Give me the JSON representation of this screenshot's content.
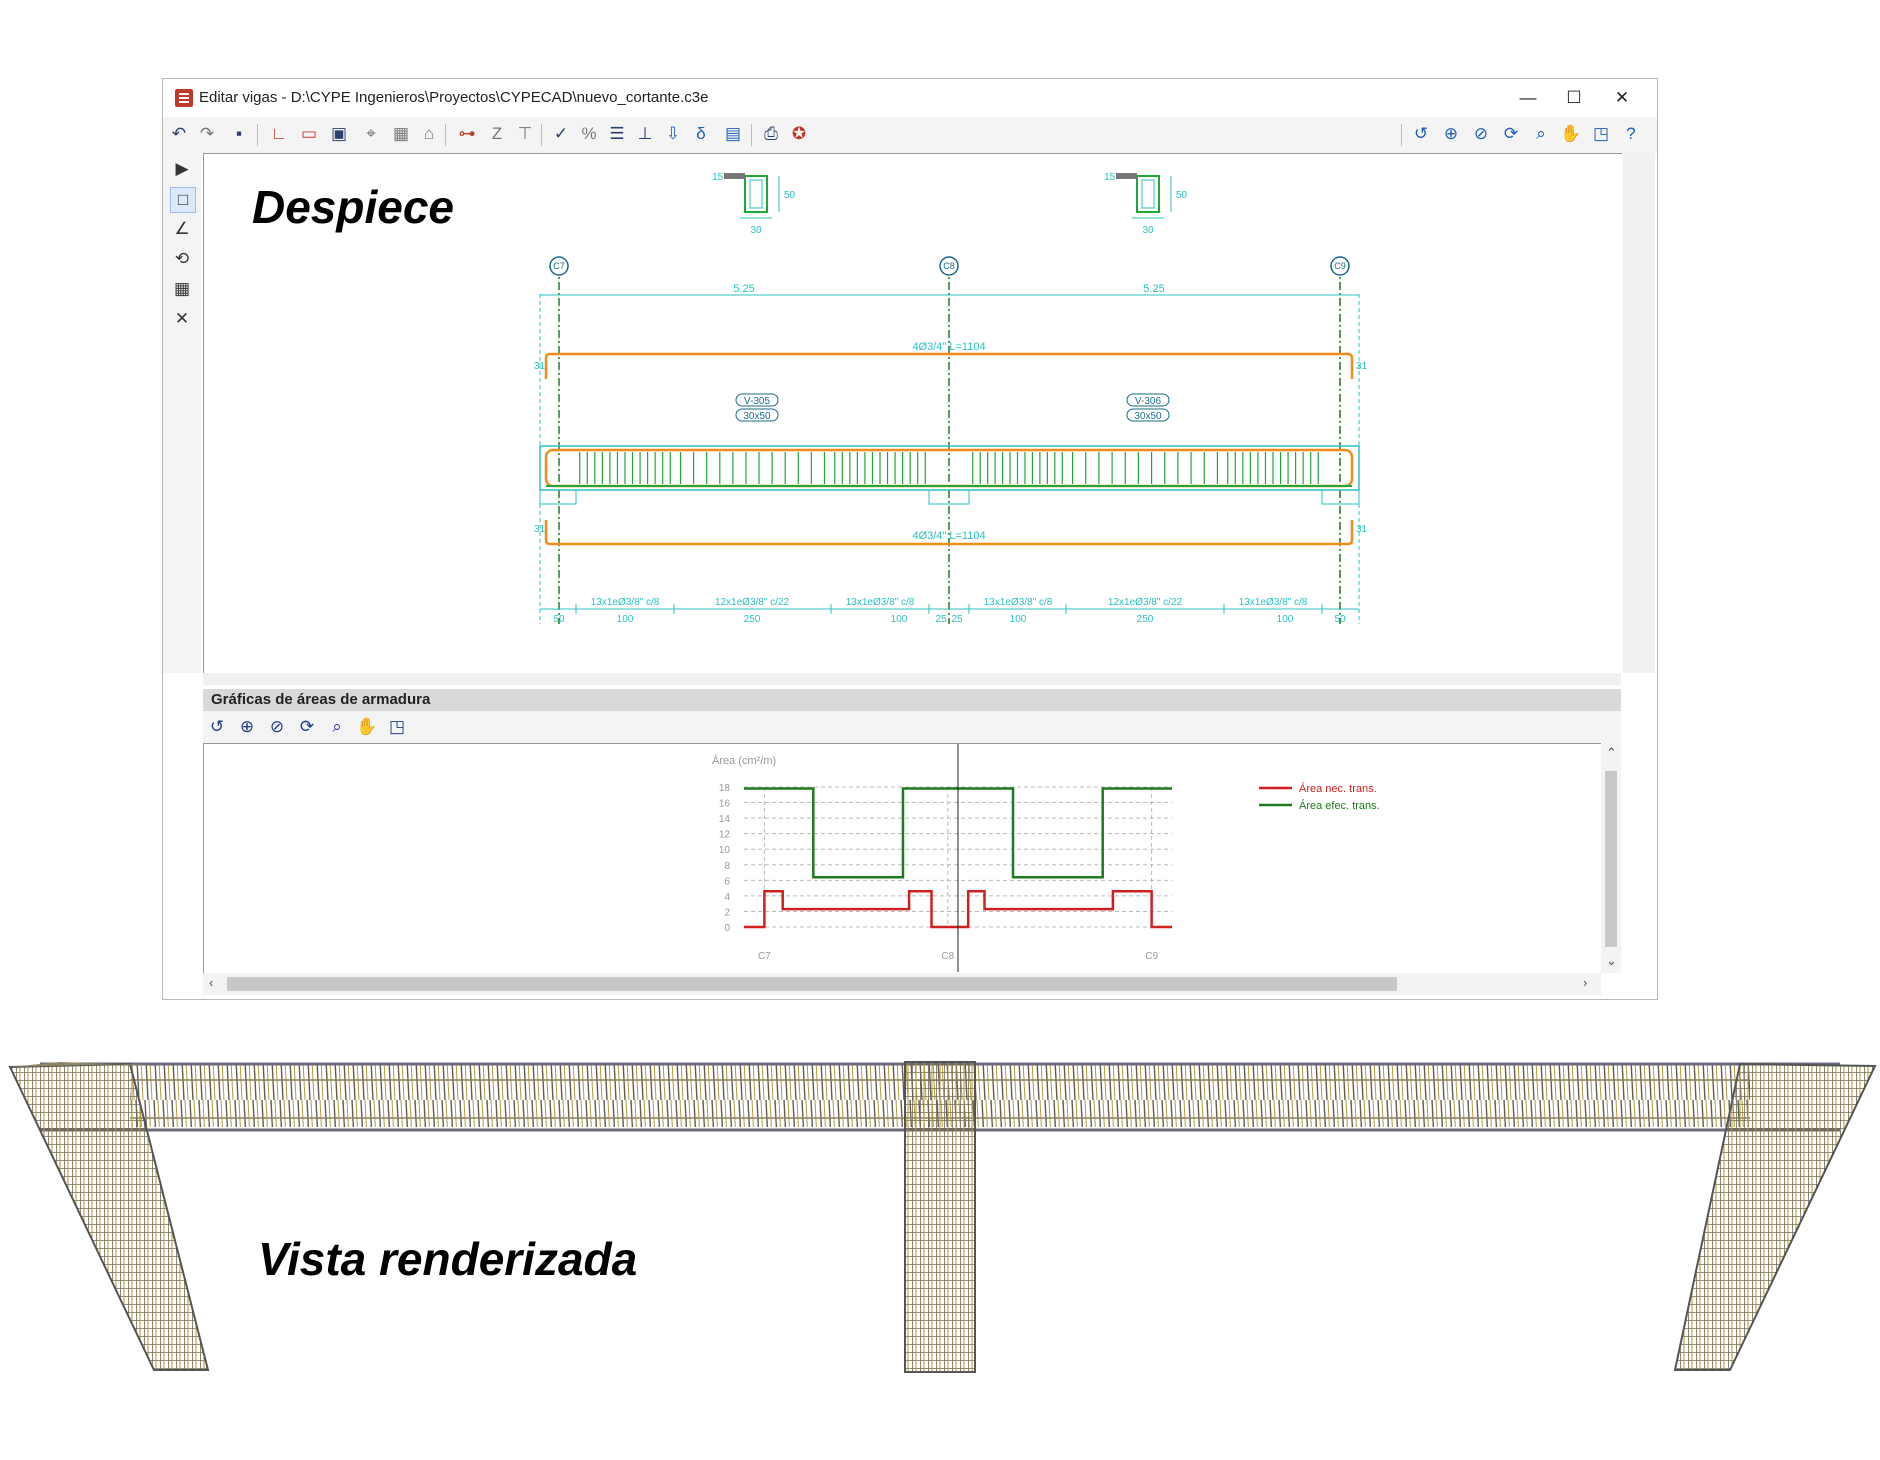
{
  "window": {
    "title": "Editar vigas - D:\\CYPE Ingenieros\\Proyectos\\CYPECAD\\nuevo_cortante.c3e",
    "controls": {
      "minimize": "—",
      "maximize": "☐",
      "close": "✕"
    }
  },
  "toolbar": {
    "undo_icon": "↶",
    "redo_icon": "↷",
    "save_icon": "🖫",
    "right_icons": [
      "zoom-previous-icon",
      "zoom-all-icon",
      "zoom-x2-icon",
      "refresh-icon",
      "zoom-window-icon",
      "pan-hand-icon",
      "window-icon",
      "help-icon"
    ]
  },
  "captions": {
    "despiece": "Despiece",
    "vista": "Vista renderizada"
  },
  "drawing": {
    "section_dims": {
      "width": "30",
      "height": "50",
      "flange": "15"
    },
    "columns": [
      "C7",
      "C8",
      "C9"
    ],
    "spans": [
      "5.25",
      "5.25"
    ],
    "top_bar": "4Ø3/4\" L=1104",
    "bottom_bar": "4Ø3/4\" L=1104",
    "hook": "31",
    "beams": [
      {
        "name": "V-305",
        "section": "30x50"
      },
      {
        "name": "V-306",
        "section": "30x50"
      }
    ],
    "stirrups": [
      {
        "label": "13x1eØ3/8\" c/8",
        "length": "100"
      },
      {
        "label": "12x1eØ3/8\" c/22",
        "length": "250"
      },
      {
        "label": "13x1eØ3/8\" c/8",
        "length": "100"
      },
      {
        "label": "13x1eØ3/8\" c/8",
        "length": "100"
      },
      {
        "label": "12x1eØ3/8\" c/22",
        "length": "250"
      },
      {
        "label": "13x1eØ3/8\" c/8",
        "length": "100"
      }
    ],
    "support_dims": {
      "left": "50",
      "mid_a": "25",
      "mid_b": "25",
      "right": "50"
    }
  },
  "panel": {
    "title": "Gráficas de áreas de armadura"
  },
  "chart_data": {
    "type": "line",
    "ylabel": "Área (cm²/m)",
    "ylim": [
      0,
      18
    ],
    "yticks": [
      0,
      2,
      4,
      6,
      8,
      10,
      12,
      14,
      16,
      18
    ],
    "xticks": [
      "C7",
      "C8",
      "C9"
    ],
    "xlim": [
      0,
      10.5
    ],
    "legend_position": "right",
    "series": [
      {
        "name": "Área nec. trans.",
        "color": "#d01f1f",
        "x": [
          0,
          0.5,
          0.5,
          0.95,
          0.95,
          1.45,
          1.45,
          4.05,
          4.05,
          4.6,
          4.6,
          5.0,
          5.0,
          5.5,
          5.5,
          5.9,
          5.9,
          6.45,
          6.45,
          9.05,
          9.05,
          9.55,
          9.55,
          10.0,
          10.0,
          10.5
        ],
        "y": [
          0,
          0,
          4.6,
          4.6,
          2.3,
          2.3,
          2.3,
          2.3,
          4.6,
          4.6,
          0,
          0,
          0,
          0,
          4.6,
          4.6,
          2.3,
          2.3,
          2.3,
          2.3,
          4.6,
          4.6,
          4.6,
          4.6,
          0,
          0
        ]
      },
      {
        "name": "Área efec. trans.",
        "color": "#1f7a1f",
        "x": [
          0,
          1.7,
          1.7,
          3.9,
          3.9,
          6.6,
          6.6,
          8.8,
          8.8,
          10.5
        ],
        "y": [
          17.8,
          17.8,
          6.4,
          6.4,
          17.8,
          17.8,
          6.4,
          6.4,
          17.8,
          17.8
        ]
      }
    ]
  }
}
